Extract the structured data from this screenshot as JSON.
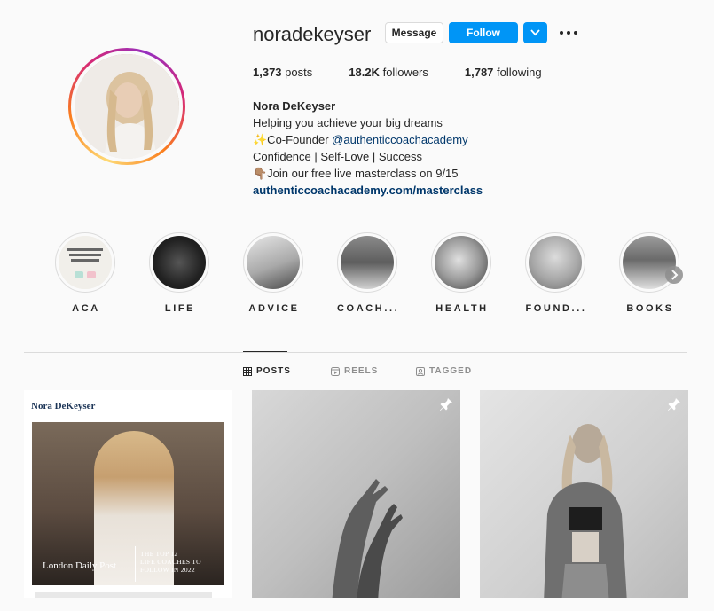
{
  "profile": {
    "username": "noradekeyser",
    "message_label": "Message",
    "follow_label": "Follow",
    "stats": [
      {
        "value": "1,373",
        "label": "posts"
      },
      {
        "value": "18.2K",
        "label": "followers"
      },
      {
        "value": "1,787",
        "label": "following"
      }
    ],
    "bio": {
      "name": "Nora DeKeyser",
      "line1": "Helping you achieve your big dreams",
      "line2_prefix": "✨Co-Founder ",
      "line2_handle": "@authenticcoachacademy",
      "line3": "Confidence | Self-Love | Success",
      "line4": "👇🏽Join our free live masterclass on 9/15",
      "link": "authenticcoachacademy.com/masterclass"
    }
  },
  "highlights": [
    {
      "label": "ACA",
      "thumb_text": "Have you thought about becoming a coach but don't know where to start?"
    },
    {
      "label": "LIFE"
    },
    {
      "label": "ADVICE"
    },
    {
      "label": "COACH..."
    },
    {
      "label": "HEALTH"
    },
    {
      "label": "FOUND..."
    },
    {
      "label": "BOOKS"
    }
  ],
  "tabs": [
    {
      "label": "POSTS",
      "icon": "grid-icon",
      "active": true
    },
    {
      "label": "REELS",
      "icon": "reels-icon",
      "active": false
    },
    {
      "label": "TAGGED",
      "icon": "tagged-icon",
      "active": false
    }
  ],
  "posts": [
    {
      "header": "Nora DeKeyser",
      "caption": "London Daily Post",
      "side_text": [
        "THE TOP 12",
        "LIFE COACHES TO",
        "FOLLOW IN 2022"
      ],
      "pinned": false
    },
    {
      "pinned": true
    },
    {
      "pinned": true
    }
  ],
  "colors": {
    "accent": "#0095f6",
    "link": "#00376b",
    "text": "#262626",
    "muted": "#8e8e8e"
  }
}
